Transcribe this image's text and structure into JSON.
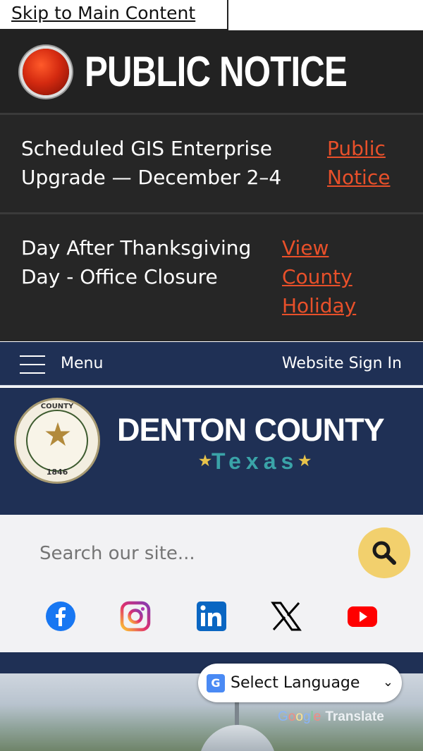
{
  "skip_link": "Skip to Main Content",
  "notice": {
    "title": "PUBLIC NOTICE"
  },
  "alerts": [
    {
      "text_line1": "Scheduled GIS Enterprise",
      "text_line2": "Upgrade — December 2–4",
      "link_line1": "Public",
      "link_line2": "Notice"
    },
    {
      "text_line1": "Day After Thanksgiving",
      "text_line2": "Day - Office Closure",
      "link_line1": "View",
      "link_line2": "County",
      "link_line3": "Holiday"
    }
  ],
  "nav": {
    "menu_label": "Menu",
    "signin_label": "Website Sign In"
  },
  "brand": {
    "county": "DENTON COUNTY",
    "state": "Texas",
    "seal_top": "COUNTY",
    "seal_year": "1846"
  },
  "search": {
    "placeholder": "Search our site..."
  },
  "social": [
    {
      "icon": "facebook-icon",
      "color": "#1877f2"
    },
    {
      "icon": "instagram-icon",
      "color": "#d6249f"
    },
    {
      "icon": "linkedin-icon",
      "color": "#0a66c2"
    },
    {
      "icon": "x-icon",
      "color": "#000000"
    },
    {
      "icon": "youtube-icon",
      "color": "#ff0000"
    }
  ],
  "translate": {
    "select_label": "Select Language",
    "powered_google": "Google",
    "powered_translate": "Translate"
  },
  "colors": {
    "navy": "#1f3055",
    "accent": "#e8502a",
    "gold": "#f2d06d",
    "teal": "#3aa3a8"
  }
}
